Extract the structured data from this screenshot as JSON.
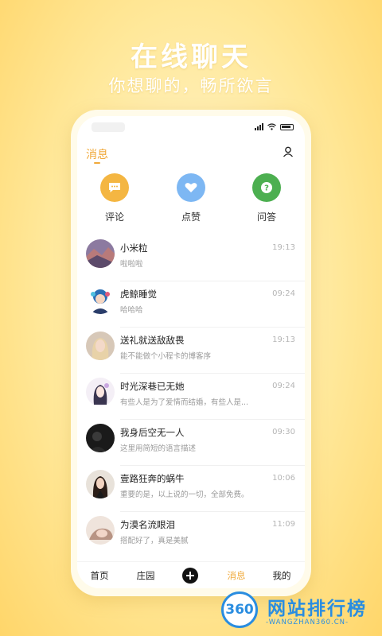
{
  "promo": {
    "headline": "在线聊天",
    "subline": "你想聊的，畅所欲言"
  },
  "header": {
    "title": "消息"
  },
  "categories": [
    {
      "label": "评论",
      "color": "#f4b642",
      "icon": "comment-icon"
    },
    {
      "label": "点赞",
      "color": "#7db7f3",
      "icon": "heart-icon"
    },
    {
      "label": "问答",
      "color": "#4caf50",
      "icon": "question-icon"
    }
  ],
  "messages": [
    {
      "name": "小米粒",
      "preview": "啦啦啦",
      "time": "19:13"
    },
    {
      "name": "虎鲸睡觉",
      "preview": "哈哈哈",
      "time": "09:24"
    },
    {
      "name": "送礼就送敌敌畏",
      "preview": "能不能做个小程卡的博客序",
      "time": "19:13"
    },
    {
      "name": "时光深巷已无她",
      "preview": "有些人是为了爱情而结婚，有些人是...",
      "time": "09:24"
    },
    {
      "name": "我身后空无一人",
      "preview": "这里用简短的语言描述",
      "time": "09:30"
    },
    {
      "name": "壹路狂奔的蜗牛",
      "preview": "重要的是，以上说的一切，全部免费。",
      "time": "10:06"
    },
    {
      "name": "为漠名流眼泪",
      "preview": "搭配好了，真是美腻",
      "time": "11:09"
    }
  ],
  "tabbar": {
    "home": "首页",
    "manor": "庄园",
    "messages": "消息",
    "mine": "我的",
    "active_color": "#f0a93a"
  },
  "watermark": {
    "logo_text": "360",
    "title": "网站排行榜",
    "url": "-WANGZHAN360.CN-"
  },
  "colors": {
    "accent": "#f0a93a",
    "background": "#ffe89a"
  }
}
